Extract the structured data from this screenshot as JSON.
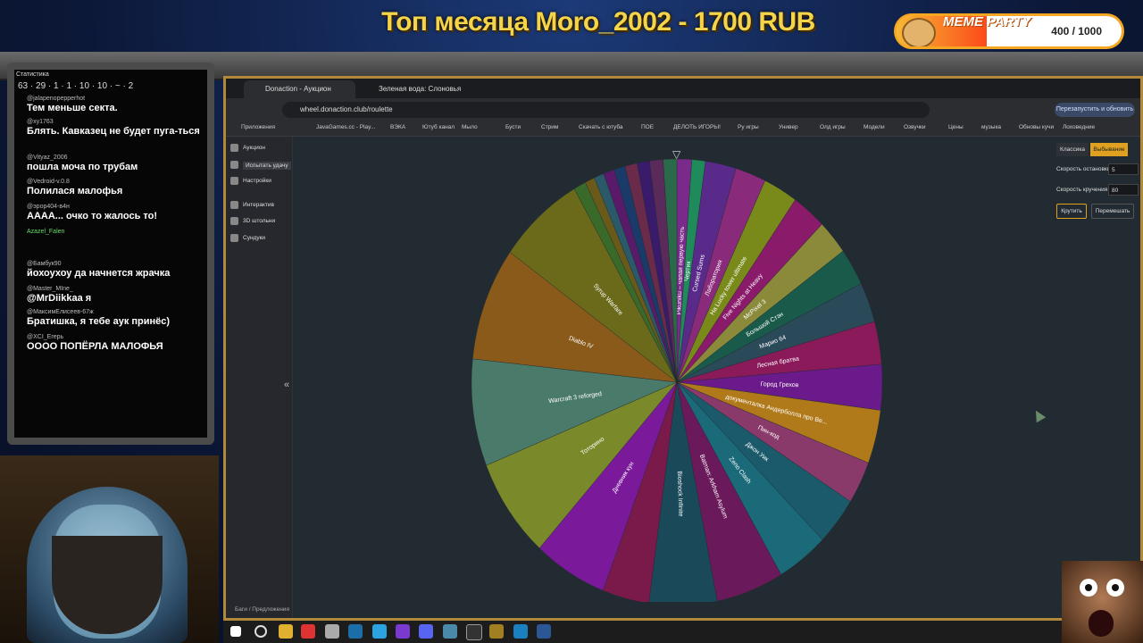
{
  "stream": {
    "title": "Топ месяца Moro_2002 - 1700 RUB",
    "meme_label": "MEME PARTY",
    "meme_count": "400 / 1000",
    "meme_progress": 0.4
  },
  "chat": {
    "stats_label": "Статистика",
    "stats_values": "63 · 29 · 1 · 1 · 10 · 10 · ~ · 2",
    "messages": [
      {
        "user": "@jalapenopepperhot",
        "text": "Тем меньше секта."
      },
      {
        "user": "@xy1763",
        "text": "Блять. Кавказец не будет пуга-ться"
      },
      {
        "user": "@Vityaz_2006",
        "text": "пошла моча по трубам"
      },
      {
        "user": "@Vedroid-v.0.8",
        "text": "Полилася малофья"
      },
      {
        "user": "@эрор404-в4н",
        "text": "АААА... очко то жалось то!"
      },
      {
        "user": "Azazel_Falen",
        "text": ""
      },
      {
        "user": "@Бамбук90",
        "text": "йохоухоу да начнется жрачка"
      },
      {
        "user": "@Master_MIne_",
        "text": "@MrDiikkaa я"
      },
      {
        "user": "@МаксимЕлисеев-67ж",
        "text": "Братишка, я тебе аук принёс)"
      },
      {
        "user": "@XCI_Егерь",
        "text": "ОООО ПОПЁРЛА МАЛОФЬЯ"
      }
    ]
  },
  "browser": {
    "tabs": [
      "Donaction - Аукцион",
      "Зеленая вода: Слоновья м..."
    ],
    "url": "wheel.donaction.club/roulette",
    "relaunch_label": "Перезапустить и обновить",
    "bookmarks": [
      "Приложения",
      "JavaGames.cc - Play...",
      "ВЭКА",
      "Ютуб канал",
      "Мыло",
      "Бусти",
      "Стрим",
      "Скачать с ютуба",
      "ПОЕ",
      "ДЕЛОТЬ ИГОРЫ!",
      "Ру игры",
      "Универ",
      "Олд игры",
      "Модели",
      "Озвучки",
      "Цены",
      "музыка",
      "Обновы кучи",
      "Лоховедние"
    ]
  },
  "sidebar": {
    "items": [
      "Аукцион",
      "Испытать удачу",
      "Настройки",
      "Интерактив",
      "3D штольни",
      "Сундуки"
    ],
    "footer": "Баги / Предложения"
  },
  "controls": {
    "mode_classic": "Классика",
    "mode_elimination": "Выбывание",
    "stop_speed_label": "Скорость остановки",
    "stop_speed_value": "5",
    "spin_speed_label": "Скорость кручения",
    "spin_speed_value": "80",
    "spin_button": "Крутить",
    "shuffle_button": "Перемешать"
  },
  "chart_data": {
    "type": "pie",
    "slices": [
      {
        "label": "Pikuniku – чапая первую часть",
        "value": 1.2,
        "color": "#7a2a8a"
      },
      {
        "label": "Чертик",
        "value": 1.1,
        "color": "#1f8a5a"
      },
      {
        "label": "Cursed Sums",
        "value": 2.5,
        "color": "#5a2a8a"
      },
      {
        "label": "Лаборатория",
        "value": 2.5,
        "color": "#8a2a7a"
      },
      {
        "label": "На Lucky tower ultimate",
        "value": 2.8,
        "color": "#7a8a1a"
      },
      {
        "label": "Five Nights at Heavy",
        "value": 2.8,
        "color": "#8a1a6a"
      },
      {
        "label": "McPixel 3",
        "value": 2.6,
        "color": "#8a8a3a"
      },
      {
        "label": "Большой Стэн",
        "value": 2.8,
        "color": "#1a5a4a"
      },
      {
        "label": "Марио 64",
        "value": 3.0,
        "color": "#2a4a5a"
      },
      {
        "label": "Лесная братва",
        "value": 3.2,
        "color": "#8a1a5a"
      },
      {
        "label": "Город Грехов",
        "value": 3.4,
        "color": "#6a1a8a"
      },
      {
        "label": "документалка Андерболла про Ве...",
        "value": 4.0,
        "color": "#b07a1a"
      },
      {
        "label": "Пин-код",
        "value": 3.2,
        "color": "#8a3a6a"
      },
      {
        "label": "Джон Уик",
        "value": 3.6,
        "color": "#1a5a6a"
      },
      {
        "label": "Zeno Clash",
        "value": 4.2,
        "color": "#1a6a7a"
      },
      {
        "label": "Batman: Arkham Asylum",
        "value": 5.5,
        "color": "#6a1a5a"
      },
      {
        "label": "Bioshock Infinite",
        "value": 5.5,
        "color": "#1a4a5a"
      },
      {
        "label": "",
        "value": 3.8,
        "color": "#7a1a4a"
      },
      {
        "label": "Дневник кун",
        "value": 6.0,
        "color": "#7a1a9a"
      },
      {
        "label": "Тоторино",
        "value": 7.5,
        "color": "#7a8a2a"
      },
      {
        "label": "Warcraft 3 reforged",
        "value": 8.0,
        "color": "#4a7a6a"
      },
      {
        "label": "Diablo IV",
        "value": 8.5,
        "color": "#8a5a1a"
      },
      {
        "label": "Syrup Warfare",
        "value": 7.0,
        "color": "#6a6a1a"
      },
      {
        "label": "",
        "value": 1.0,
        "color": "#3a6a2a"
      },
      {
        "label": "",
        "value": 0.8,
        "color": "#6a5a1a"
      },
      {
        "label": "",
        "value": 0.8,
        "color": "#2a5a6a"
      },
      {
        "label": "",
        "value": 0.9,
        "color": "#5a1a6a"
      },
      {
        "label": "",
        "value": 0.9,
        "color": "#1a3a6a"
      },
      {
        "label": "",
        "value": 1.0,
        "color": "#6a2a4a"
      },
      {
        "label": "",
        "value": 1.0,
        "color": "#3a1a6a"
      },
      {
        "label": "",
        "value": 1.1,
        "color": "#5a2a5a"
      },
      {
        "label": "",
        "value": 1.1,
        "color": "#2a6a4a"
      }
    ]
  }
}
